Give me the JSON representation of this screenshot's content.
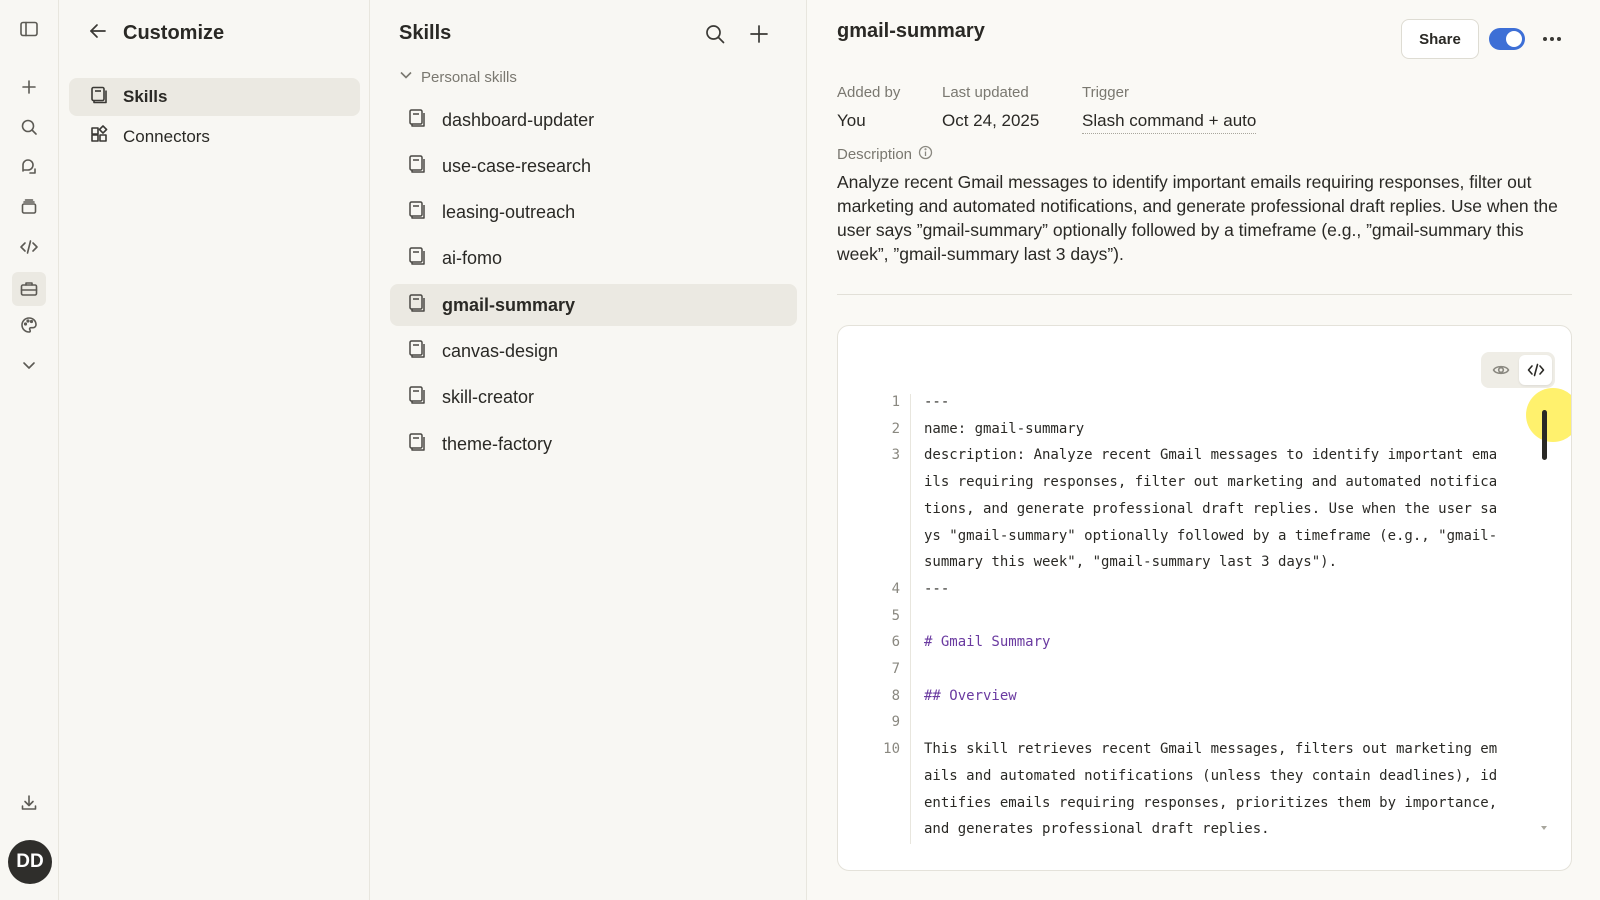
{
  "rail": {
    "avatar_initials": "DD"
  },
  "customize": {
    "title": "Customize",
    "nav": [
      {
        "label": "Skills",
        "icon": "skills-icon"
      },
      {
        "label": "Connectors",
        "icon": "connectors-icon"
      }
    ]
  },
  "skills_panel": {
    "title": "Skills",
    "group_label": "Personal skills",
    "items": [
      "dashboard-updater",
      "use-case-research",
      "leasing-outreach",
      "ai-fomo",
      "gmail-summary",
      "canvas-design",
      "skill-creator",
      "theme-factory"
    ],
    "selected": "gmail-summary"
  },
  "detail": {
    "name": "gmail-summary",
    "share_label": "Share",
    "enabled": true,
    "meta": {
      "added_by_label": "Added by",
      "added_by": "You",
      "updated_label": "Last updated",
      "updated": "Oct 24, 2025",
      "trigger_label": "Trigger",
      "trigger": "Slash command + auto"
    },
    "description_label": "Description",
    "description": "Analyze recent Gmail messages to identify important emails requiring responses, filter out marketing and automated notifications, and generate professional draft replies. Use when the user says ”gmail-summary” optionally followed by a timeframe (e.g., ”gmail-summary this week”, ”gmail-summary last 3 days”).",
    "code": [
      {
        "n": "1",
        "lines": [
          "---"
        ]
      },
      {
        "n": "2",
        "lines": [
          "name: gmail-summary"
        ]
      },
      {
        "n": "3",
        "lines": [
          "description: Analyze recent Gmail messages to identify important ema",
          "ils requiring responses, filter out marketing and automated notifica",
          "tions, and generate professional draft replies. Use when the user sa",
          "ys \"gmail-summary\" optionally followed by a timeframe (e.g., \"gmail-",
          "summary this week\", \"gmail-summary last 3 days\")."
        ]
      },
      {
        "n": "4",
        "lines": [
          "---"
        ]
      },
      {
        "n": "5",
        "lines": [
          ""
        ]
      },
      {
        "n": "6",
        "lines": [
          "# Gmail Summary"
        ],
        "heading": true
      },
      {
        "n": "7",
        "lines": [
          ""
        ]
      },
      {
        "n": "8",
        "lines": [
          "## Overview"
        ],
        "heading": true
      },
      {
        "n": "9",
        "lines": [
          ""
        ]
      },
      {
        "n": "10",
        "lines": [
          "This skill retrieves recent Gmail messages, filters out marketing em",
          "ails and automated notifications (unless they contain deadlines), id",
          "entifies emails requiring responses, prioritizes them by importance,",
          "and generates professional draft replies."
        ]
      }
    ]
  },
  "colors": {
    "accent": "#3d6fd6",
    "heading_code": "#6a3aa0"
  }
}
